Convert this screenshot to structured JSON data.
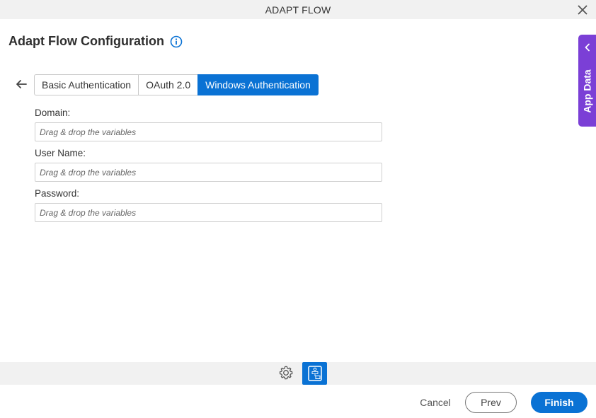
{
  "window": {
    "title": "ADAPT FLOW"
  },
  "page": {
    "heading": "Adapt Flow Configuration"
  },
  "tabs": [
    {
      "label": "Basic Authentication",
      "active": false
    },
    {
      "label": "OAuth 2.0",
      "active": false
    },
    {
      "label": "Windows Authentication",
      "active": true
    }
  ],
  "fields": [
    {
      "label": "Domain:",
      "placeholder": "Drag & drop the variables"
    },
    {
      "label": "User Name:",
      "placeholder": "Drag & drop the variables"
    },
    {
      "label": "Password:",
      "placeholder": "Drag & drop the variables"
    }
  ],
  "side_panel": {
    "label": "App Data"
  },
  "footer": {
    "cancel": "Cancel",
    "prev": "Prev",
    "finish": "Finish"
  },
  "colors": {
    "primary": "#0a72d4",
    "side_panel": "#7b3fd6",
    "toolbar_bg": "#f1f1f1"
  },
  "icons": [
    "close-icon",
    "info-icon",
    "back-arrow-icon",
    "chevron-left-icon",
    "gear-icon",
    "flow-diagram-icon"
  ]
}
